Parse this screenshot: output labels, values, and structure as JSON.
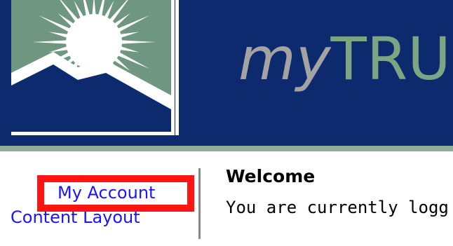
{
  "header": {
    "brand_prefix": "my",
    "brand_suffix": "TRU",
    "colors": {
      "navy": "#0d2a6e",
      "sage": "#7ba583",
      "grey": "#a3a3a3"
    }
  },
  "nav": {
    "items": [
      {
        "label": "My Account",
        "highlighted": true
      },
      {
        "label": "Content Layout"
      }
    ],
    "link_color": "#1a14ff",
    "highlight_color": "#ff1414"
  },
  "main": {
    "title": "Welcome",
    "text": "You are currently logg"
  }
}
